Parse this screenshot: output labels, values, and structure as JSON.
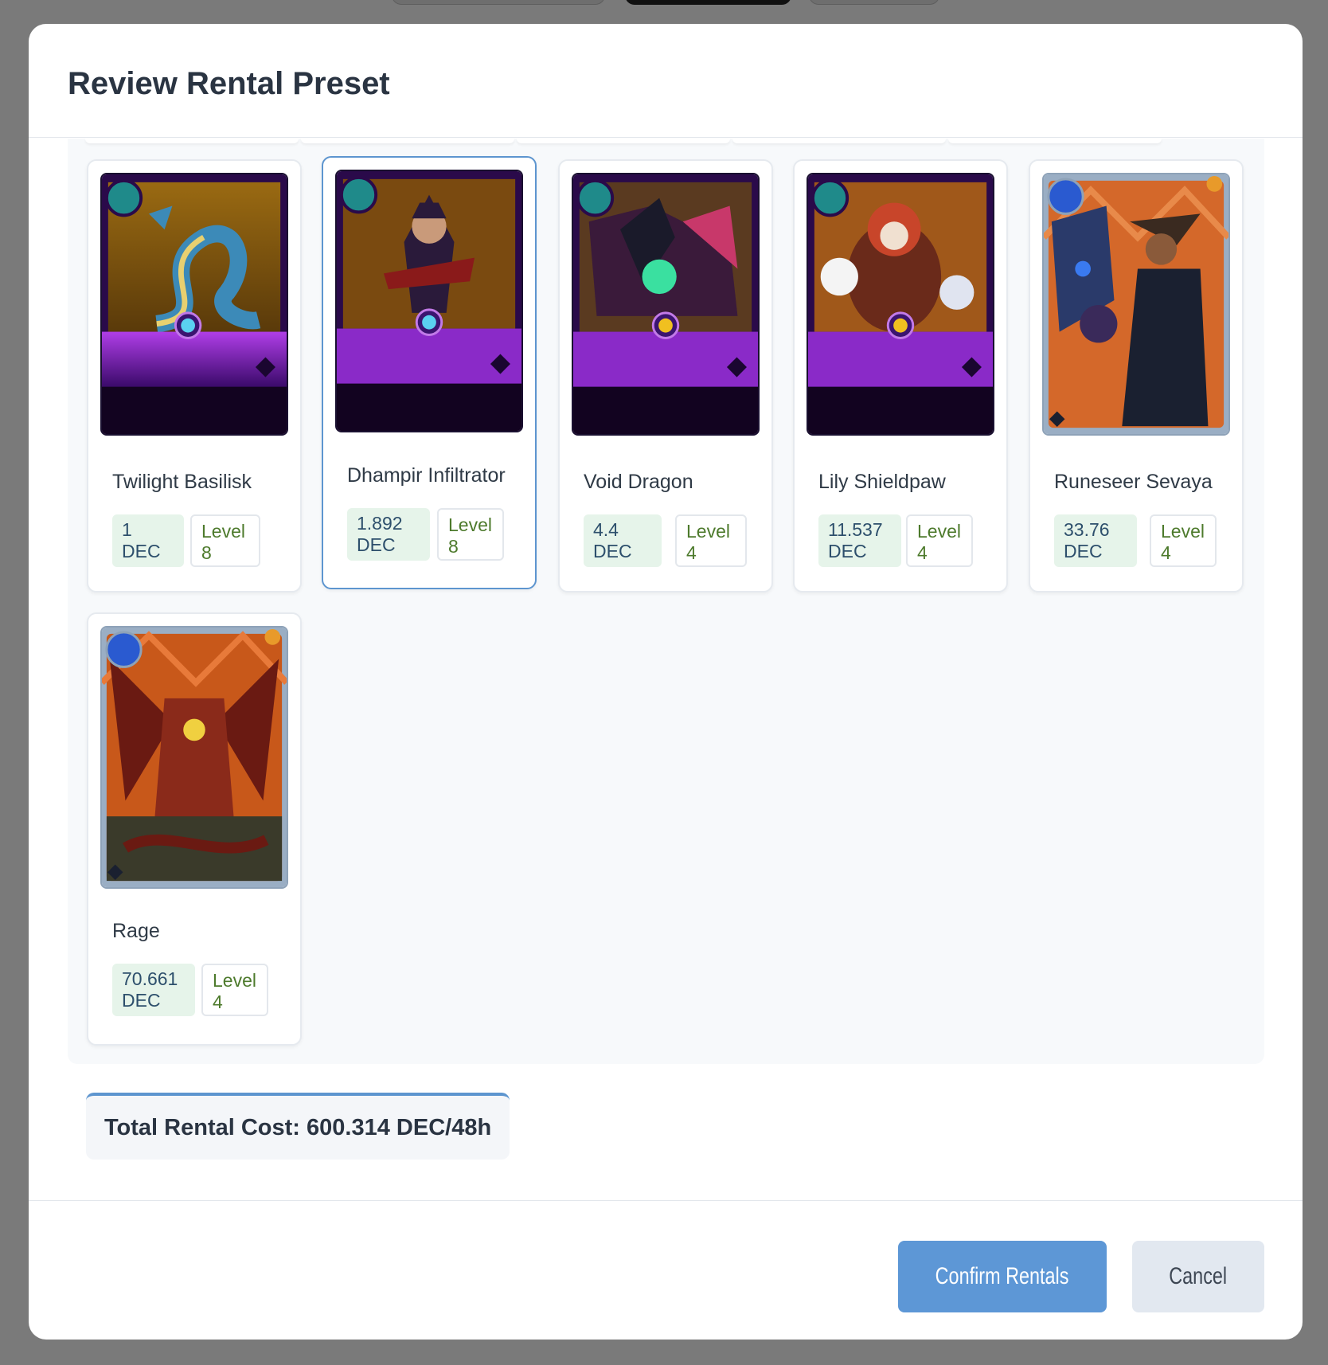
{
  "modal": {
    "title": "Review Rental Preset"
  },
  "cards": [
    {
      "name": "Twilight Basilisk",
      "price": "1\nDEC",
      "price_amount": "1",
      "price_unit": "DEC",
      "level_label": "Level",
      "level_value": "8",
      "selected": false,
      "gem": "teal",
      "frame": "purple"
    },
    {
      "name": "Dhampir Infiltrator",
      "price_amount": "1.892",
      "price_unit": "DEC",
      "level_label": "Level",
      "level_value": "8",
      "selected": true,
      "gem": "teal",
      "frame": "purple"
    },
    {
      "name": "Void Dragon",
      "price_amount": "4.4",
      "price_unit": "DEC",
      "level_label": "Level",
      "level_value": "4",
      "selected": false,
      "gem": "teal",
      "frame": "purple"
    },
    {
      "name": "Lily Shieldpaw",
      "price_amount": "11.537",
      "price_unit": "DEC",
      "level_label": "Level",
      "level_value": "4",
      "selected": false,
      "gem": "teal",
      "frame": "purple"
    },
    {
      "name": "Runeseer Sevaya",
      "price_amount": "33.76",
      "price_unit": "DEC",
      "level_label": "Level",
      "level_value": "4",
      "selected": false,
      "gem": "blue",
      "frame": "silver"
    },
    {
      "name": "Rage",
      "price_amount": "70.661",
      "price_unit": "DEC",
      "level_label": "Level",
      "level_value": "4",
      "selected": false,
      "gem": "blue",
      "frame": "silver"
    }
  ],
  "summary": {
    "total_text": "Total Rental Cost: 600.314 DEC/48h"
  },
  "footer": {
    "confirm_label": "Confirm Rentals",
    "cancel_label": "Cancel"
  },
  "colors": {
    "accent": "#5d95cf",
    "price_bg": "#e6f4ea",
    "level_text": "#4d7a2c"
  }
}
